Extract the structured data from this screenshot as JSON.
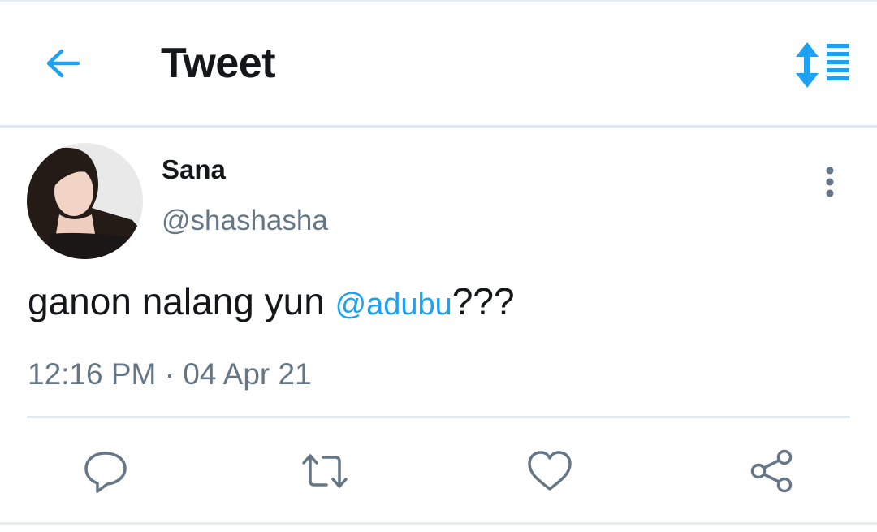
{
  "header": {
    "title": "Tweet",
    "back_icon": "arrow-left-icon",
    "sort_icon": "sort-list-icon",
    "accent_color": "#1da1f2"
  },
  "tweet": {
    "author": {
      "name": "Sana",
      "handle": "@shashasha"
    },
    "text": {
      "prefix": "ganon nalang yun ",
      "mention": "@adubu",
      "suffix": "???"
    },
    "time": "12:16 PM",
    "separator": "·",
    "date": "04 Apr 21",
    "more_icon": "more-vertical-icon"
  },
  "actions": [
    {
      "name": "reply",
      "icon": "reply-icon"
    },
    {
      "name": "retweet",
      "icon": "retweet-icon"
    },
    {
      "name": "like",
      "icon": "heart-icon"
    },
    {
      "name": "share",
      "icon": "share-icon"
    }
  ],
  "colors": {
    "text": "#14171a",
    "secondary": "#657786",
    "link": "#1da1f2",
    "divider": "#e1e8ed"
  }
}
